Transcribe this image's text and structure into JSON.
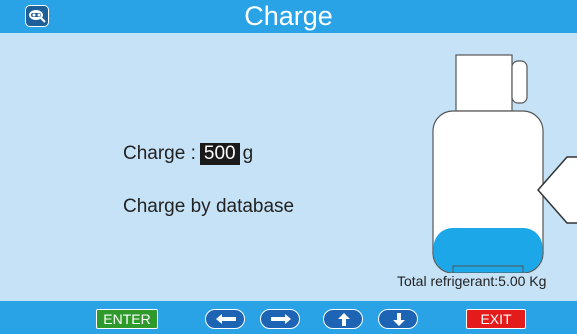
{
  "header": {
    "title": "Charge",
    "app_icon": "refrigerant-machine-icon"
  },
  "main": {
    "charge_label": "Charge :",
    "charge_value": "500",
    "charge_unit": "g",
    "database_text": "Charge by database",
    "tank": {
      "fill_level": 0.25,
      "indicator": "arrow-left-icon"
    },
    "total_refrigerant": "Total refrigerant:5.00 Kg"
  },
  "footer": {
    "enter_label": "ENTER",
    "exit_label": "EXIT",
    "arrow_icons": [
      "arrow-left-icon",
      "arrow-right-icon",
      "arrow-up-icon",
      "arrow-down-icon"
    ]
  },
  "colors": {
    "header_bar": "#2aa3e6",
    "background": "#c6e2f7",
    "enter_button": "#2f9a2c",
    "exit_button": "#e41b1b",
    "arrow_button": "#1e64b5",
    "tank_liquid": "#1ba7e8",
    "value_highlight": "#1a1a1a"
  }
}
